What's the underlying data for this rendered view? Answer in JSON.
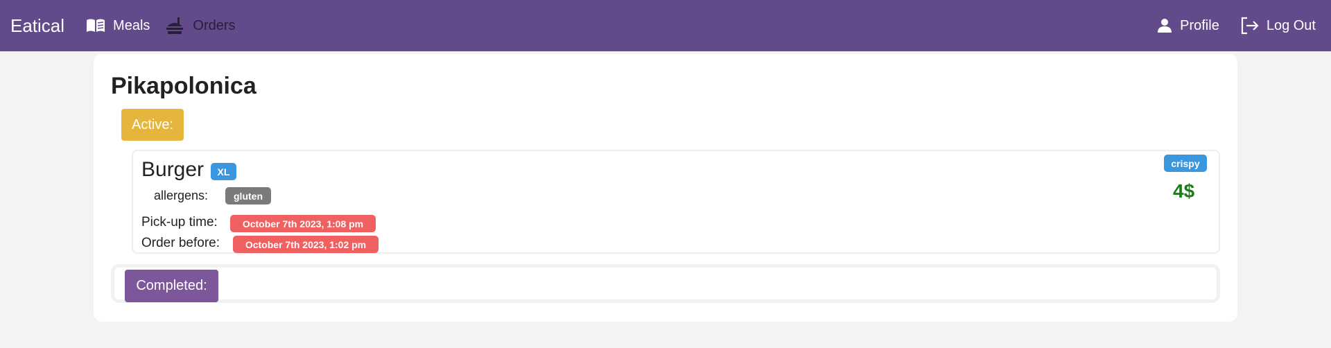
{
  "navbar": {
    "brand": "Eatical",
    "meals_label": "Meals",
    "orders_label": "Orders",
    "profile_label": "Profile",
    "logout_label": "Log Out"
  },
  "page": {
    "restaurant_name": "Pikapolonica",
    "active_label": "Active:",
    "completed_label": "Completed:"
  },
  "orders": {
    "active": [
      {
        "meal_name": "Burger",
        "size": "XL",
        "allergens_label": "allergens:",
        "allergens": [
          "gluten"
        ],
        "pickup_label": "Pick-up time:",
        "pickup_time": "October 7th 2023, 1:08 pm",
        "order_before_label": "Order before:",
        "order_before": "October 7th 2023, 1:02 pm",
        "tag": "crispy",
        "price": "4$"
      }
    ]
  },
  "colors": {
    "navbar_bg": "#634a8a",
    "active_button": "#e6b53e",
    "completed_button": "#7c5799",
    "info_badge": "#3b97dd",
    "time_badge": "#f06060",
    "allergen_badge": "#7a7a7a",
    "price": "#1a7d1a"
  }
}
